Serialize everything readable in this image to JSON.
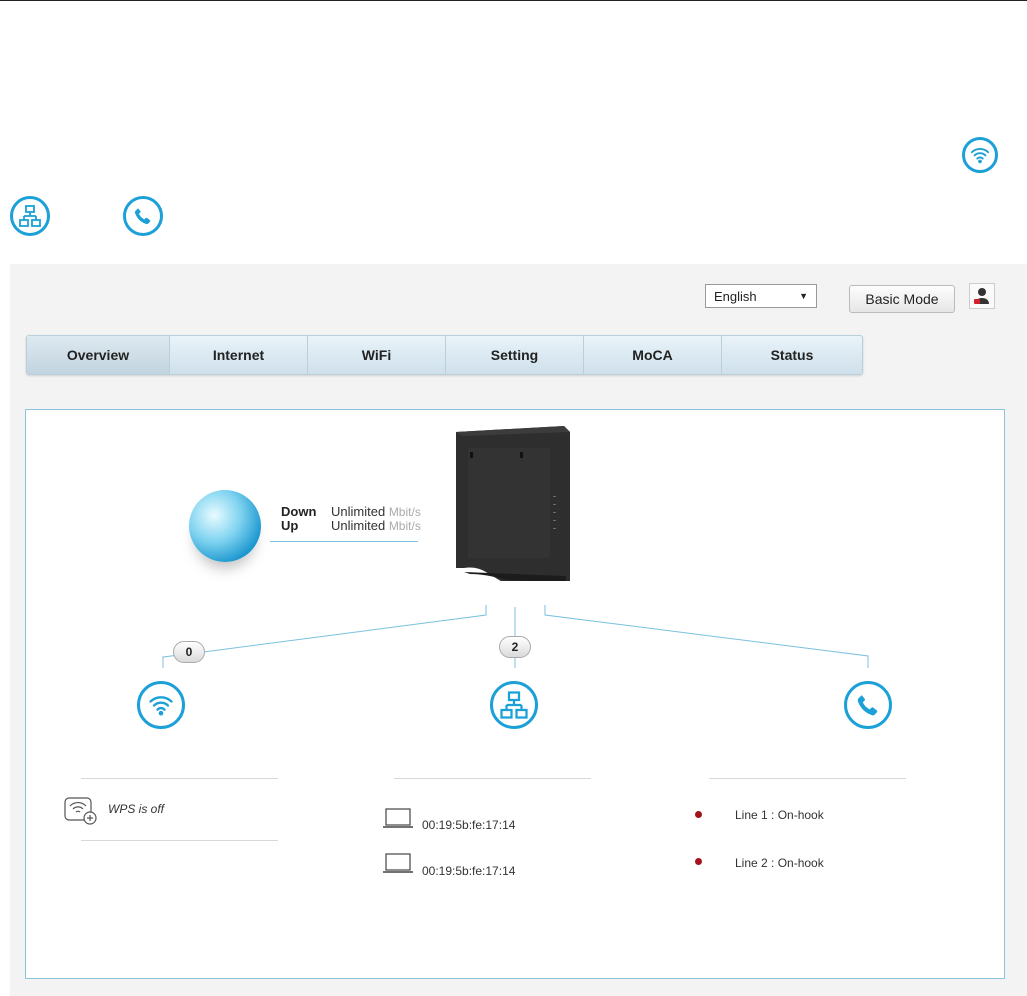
{
  "header": {
    "language": "English",
    "basic_mode_label": "Basic Mode"
  },
  "legend_icons": [
    "wifi-icon",
    "lan-icon",
    "phone-icon"
  ],
  "tabs": [
    {
      "label": "Overview"
    },
    {
      "label": "Internet"
    },
    {
      "label": "WiFi"
    },
    {
      "label": "Setting"
    },
    {
      "label": "MoCA"
    },
    {
      "label": "Status"
    }
  ],
  "internet": {
    "down_label": "Down",
    "down_value": "Unlimited",
    "up_label": "Up",
    "up_value": "Unlimited",
    "unit": "Mbit/s"
  },
  "wifi": {
    "count": "0",
    "wps_status": "WPS is off"
  },
  "lan": {
    "count": "2",
    "devices": [
      "00:19:5b:fe:17:14",
      "00:19:5b:fe:17:14"
    ]
  },
  "phone": {
    "lines": [
      "Line 1 : On-hook",
      "Line 2 : On-hook"
    ]
  },
  "colors": {
    "accent": "#1ba0d7",
    "line_status": "#a3131b"
  }
}
